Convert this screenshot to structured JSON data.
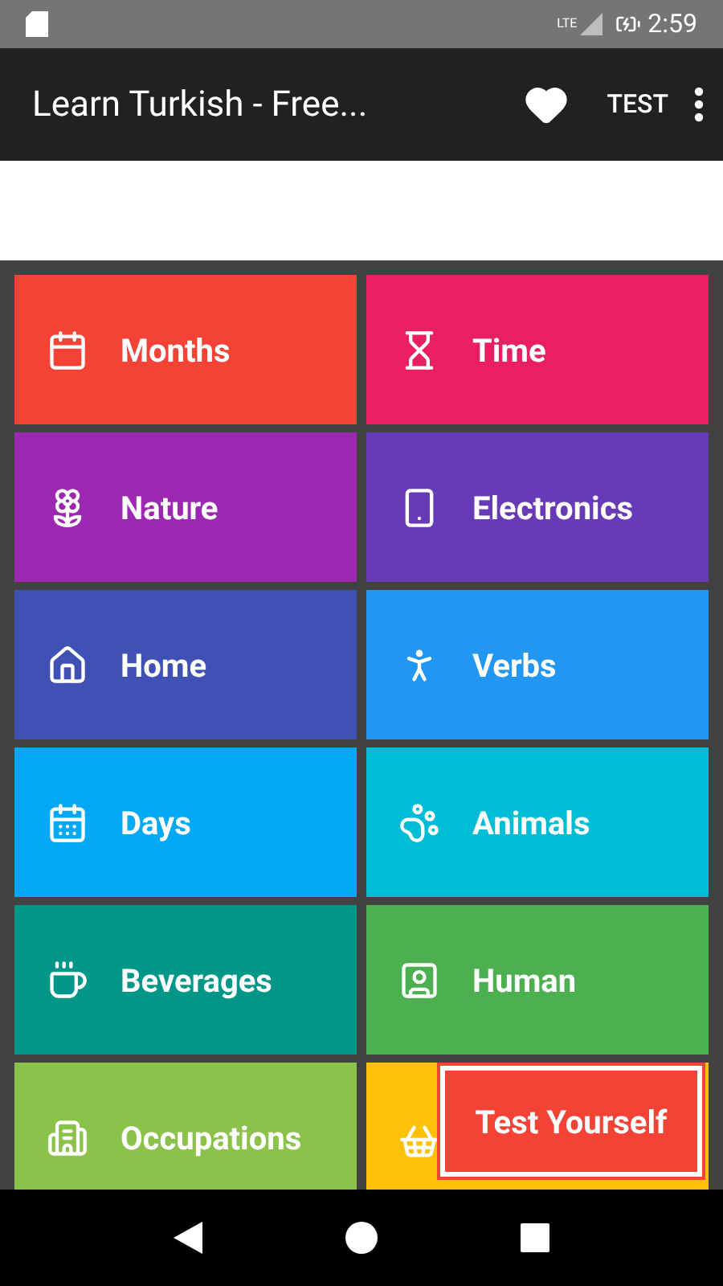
{
  "status_bar": {
    "network": "LTE",
    "time": "2:59"
  },
  "app_bar": {
    "title": "Learn Turkish - Free...",
    "action": "TEST"
  },
  "categories": [
    {
      "label": "Months",
      "color": "#f44336"
    },
    {
      "label": "Time",
      "color": "#e91e63"
    },
    {
      "label": "Nature",
      "color": "#9c27b0"
    },
    {
      "label": "Electronics",
      "color": "#673ab7"
    },
    {
      "label": "Home",
      "color": "#3f51b5"
    },
    {
      "label": "Verbs",
      "color": "#2196f3"
    },
    {
      "label": "Days",
      "color": "#03a9f4"
    },
    {
      "label": "Animals",
      "color": "#00bcd4"
    },
    {
      "label": "Beverages",
      "color": "#009688"
    },
    {
      "label": "Human",
      "color": "#4caf50"
    },
    {
      "label": "Occupations",
      "color": "#8bc34a"
    },
    {
      "color": "#ffc107"
    }
  ],
  "floating_button": {
    "label": "Test Yourself"
  }
}
